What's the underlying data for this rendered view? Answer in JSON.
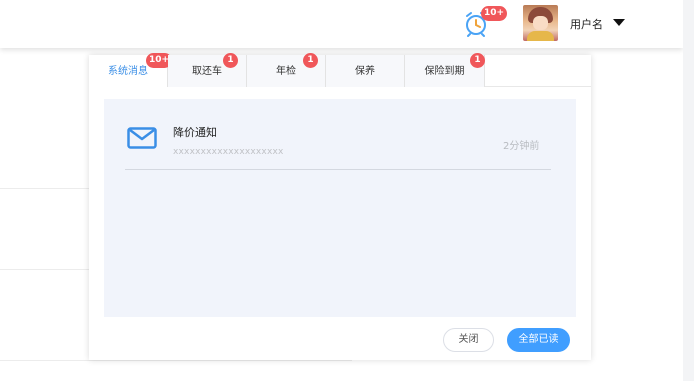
{
  "header": {
    "alarm_badge": "10+",
    "username": "用户名"
  },
  "popup": {
    "tabs": [
      {
        "label": "系统消息",
        "badge": "10+"
      },
      {
        "label": "取还车",
        "badge": "1"
      },
      {
        "label": "年检",
        "badge": "1"
      },
      {
        "label": "保养",
        "badge": ""
      },
      {
        "label": "保险到期",
        "badge": "1"
      }
    ],
    "notice": {
      "title": "降价通知",
      "subtitle": "xxxxxxxxxxxxxxxxxxxx",
      "time": "2分钟前"
    },
    "buttons": {
      "close": "关闭",
      "read_all": "全部已读"
    }
  },
  "colors": {
    "accent": "#409eff",
    "badge": "#f0575a",
    "content_bg": "#f1f4fb"
  }
}
